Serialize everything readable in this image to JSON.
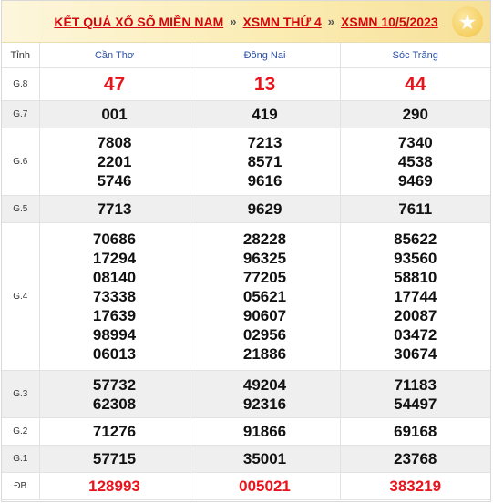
{
  "header": {
    "title": "KẾT QUẢ XỔ SỐ MIỀN NAM",
    "sep1": "»",
    "link2": "XSMN THỨ 4",
    "sep2": "»",
    "link3": "XSMN 10/5/2023",
    "logo": "star-logo-icon"
  },
  "table": {
    "label_header": "Tỉnh",
    "provinces": [
      "Cần Thơ",
      "Đồng Nai",
      "Sóc Trăng"
    ],
    "g8": {
      "label": "G.8",
      "values": [
        "47",
        "13",
        "44"
      ]
    },
    "g7": {
      "label": "G.7",
      "values": [
        "001",
        "419",
        "290"
      ]
    },
    "g6": {
      "label": "G.6",
      "values": [
        [
          "7808",
          "2201",
          "5746"
        ],
        [
          "7213",
          "8571",
          "9616"
        ],
        [
          "7340",
          "4538",
          "9469"
        ]
      ]
    },
    "g5": {
      "label": "G.5",
      "values": [
        "7713",
        "9629",
        "7611"
      ]
    },
    "g4": {
      "label": "G.4",
      "values": [
        [
          "70686",
          "17294",
          "08140",
          "73338",
          "17639",
          "98994",
          "06013"
        ],
        [
          "28228",
          "96325",
          "77205",
          "05621",
          "90607",
          "02956",
          "21886"
        ],
        [
          "85622",
          "93560",
          "58810",
          "17744",
          "20087",
          "03472",
          "30674"
        ]
      ]
    },
    "g3": {
      "label": "G.3",
      "values": [
        [
          "57732",
          "62308"
        ],
        [
          "49204",
          "92316"
        ],
        [
          "71183",
          "54497"
        ]
      ]
    },
    "g2": {
      "label": "G.2",
      "values": [
        "71276",
        "91866",
        "69168"
      ]
    },
    "g1": {
      "label": "G.1",
      "values": [
        "57715",
        "35001",
        "23768"
      ]
    },
    "db": {
      "label": "ĐB",
      "values": [
        "128993",
        "005021",
        "383219"
      ]
    }
  },
  "colors": {
    "accent": "#d4070c",
    "special": "#e8131b",
    "province": "#2a4fa8"
  }
}
